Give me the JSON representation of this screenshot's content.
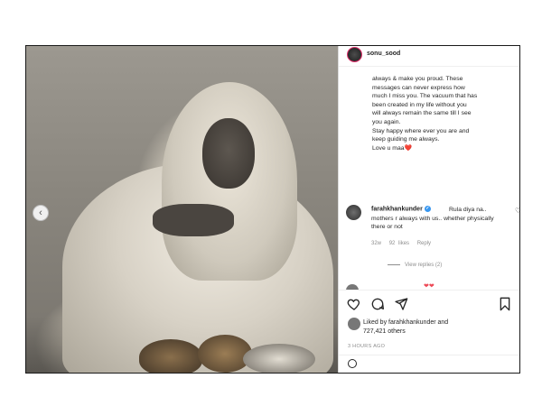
{
  "post": {
    "username": "sonu_sood",
    "caption_lines": [
      "always & make you proud. These",
      "messages can never express how",
      "much I miss you. The vacuum that has",
      "been created in my life without you",
      "will always remain the same till I see",
      "you again.",
      "Stay happy where ever you are and",
      "keep guiding me always.",
      "Love u maa"
    ],
    "caption_heart": "❤️",
    "carousel_prev_icon": "chevron-left-icon"
  },
  "comment": {
    "username": "farahkhankunder",
    "text": "Rula diya na.. mothers r always with us.. whether physically there or not",
    "time": "32w",
    "likes": "92 likes",
    "reply": "Reply",
    "view_replies": "View replies (2)"
  },
  "peek": {
    "hearts": "❤❤"
  },
  "likes": {
    "line1": "Liked by farahkhankunder and",
    "line2": "727,421 others"
  },
  "timestamp": "3 HOURS AGO",
  "colors": {
    "accent_heart": "#ed4956",
    "verified_blue": "#3897f0",
    "muted": "#8e8e8e"
  }
}
